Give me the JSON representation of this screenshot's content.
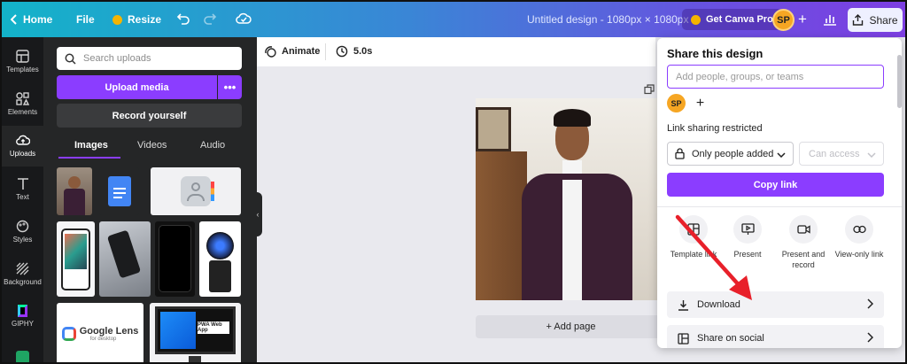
{
  "topbar": {
    "home": "Home",
    "file": "File",
    "resize": "Resize",
    "title": "Untitled design - 1080px × 1080px",
    "get_pro": "Get Canva Pro",
    "avatar": "SP",
    "share": "Share"
  },
  "rail": {
    "items": [
      {
        "label": "Templates",
        "icon": "templates-icon"
      },
      {
        "label": "Elements",
        "icon": "elements-icon"
      },
      {
        "label": "Uploads",
        "icon": "upload-cloud-icon"
      },
      {
        "label": "Text",
        "icon": "text-icon"
      },
      {
        "label": "Styles",
        "icon": "palette-icon"
      },
      {
        "label": "Background",
        "icon": "background-icon"
      },
      {
        "label": "GIPHY",
        "icon": "giphy-icon"
      }
    ]
  },
  "uploads": {
    "search_placeholder": "Search uploads",
    "upload_media": "Upload media",
    "more": "•••",
    "record": "Record yourself",
    "tabs": [
      "Images",
      "Videos",
      "Audio"
    ],
    "google_lens_title": "Google Lens",
    "google_lens_sub": "for desktop",
    "web_app_label": "PWA Web App"
  },
  "editor": {
    "animate": "Animate",
    "duration": "5.0s",
    "add_page": "+ Add page"
  },
  "share_panel": {
    "title": "Share this design",
    "people_placeholder": "Add people, groups, or teams",
    "avatar": "SP",
    "add": "+",
    "link_label": "Link sharing restricted",
    "access_value": "Only people added",
    "permission_value": "Can access",
    "copy_link": "Copy link",
    "options": [
      {
        "label": "Template link",
        "icon": "template-link-icon"
      },
      {
        "label": "Present",
        "icon": "present-icon"
      },
      {
        "label": "Present and record",
        "icon": "record-icon"
      },
      {
        "label": "View-only link",
        "icon": "link-icon"
      }
    ],
    "rows": [
      {
        "label": "Download",
        "icon": "download-icon"
      },
      {
        "label": "Share on social",
        "icon": "social-icon"
      }
    ]
  },
  "colors": {
    "accent": "#8b3dff",
    "topbar_start": "#13b3c9",
    "topbar_end": "#7d3fe2",
    "panel_bg": "#252627",
    "rail_bg": "#18191b",
    "annotation_arrow": "#e8202a"
  }
}
